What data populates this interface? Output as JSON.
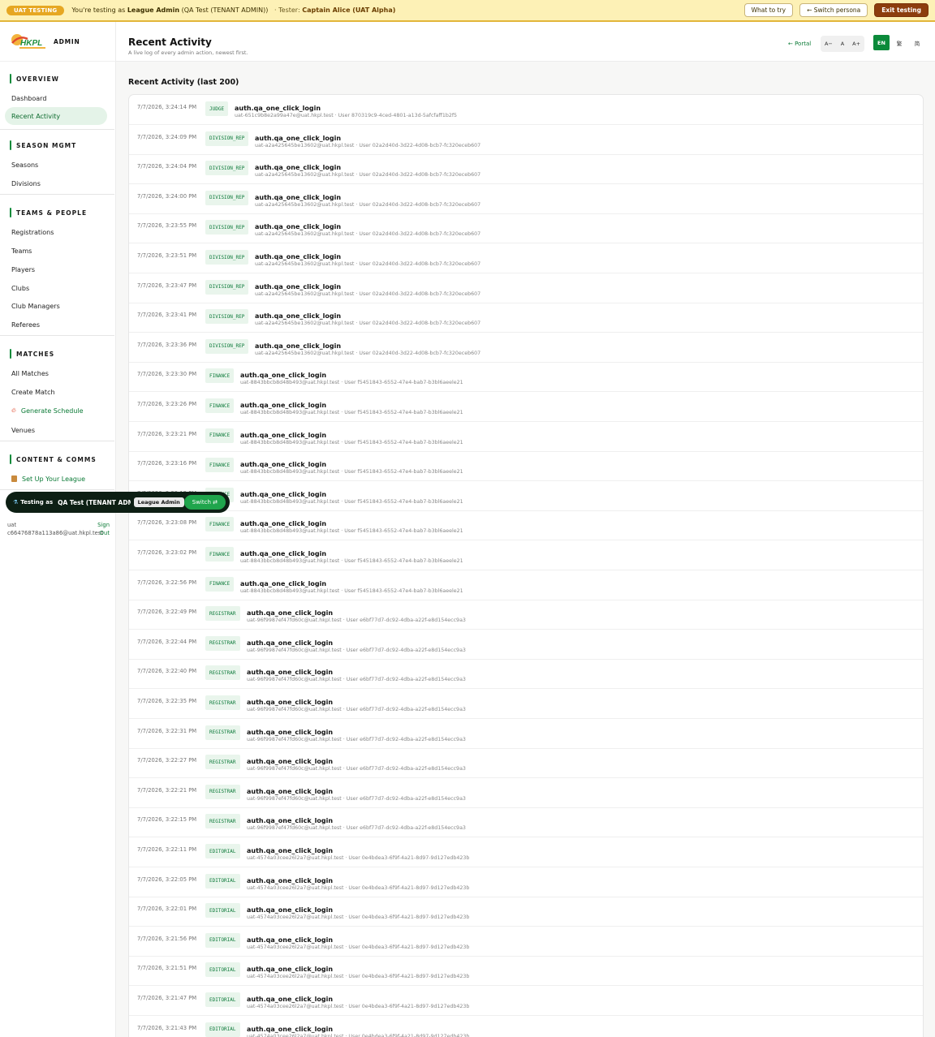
{
  "banner": {
    "pill": "UAT TESTING",
    "prefix": "You're testing as",
    "role": "League Admin",
    "role_detail": "(QA Test (TENANT ADMIN))",
    "tester_label": "· Tester:",
    "tester": "Captain Alice (UAT Alpha)",
    "what_to_try": "What to try",
    "switch_persona": "← Switch persona",
    "exit": "Exit testing"
  },
  "sidebar": {
    "brand_admin": "ADMIN",
    "sections": [
      {
        "title": "OVERVIEW",
        "items": [
          "Dashboard",
          "Recent Activity"
        ]
      },
      {
        "title": "SEASON MGMT",
        "items": [
          "Seasons",
          "Divisions"
        ]
      },
      {
        "title": "TEAMS & PEOPLE",
        "items": [
          "Registrations",
          "Teams",
          "Players",
          "Clubs",
          "Club Managers",
          "Referees"
        ]
      },
      {
        "title": "MATCHES",
        "items": [
          "All Matches",
          "Create Match",
          "Generate Schedule",
          "Venues"
        ]
      },
      {
        "title": "CONTENT & COMMS",
        "items": [
          "Set Up Your League"
        ]
      }
    ],
    "testing_pill": {
      "label": "Testing as",
      "name": "QA Test (TENANT ADMIN)",
      "persona": "League Admin",
      "switch": "Switch ⇄"
    },
    "user": {
      "line1": "uat",
      "line2": "c66476878a113a86@uat.hkpl.test",
      "signout1": "Sign",
      "signout2": "Out"
    }
  },
  "header": {
    "title": "Recent Activity",
    "subtitle": "A live log of every admin action, newest first.",
    "portal": "← Portal",
    "font_small": "A−",
    "font_normal": "A",
    "font_large": "A+",
    "lang_en": "EN",
    "lang_tc": "繁",
    "lang_sc": "简"
  },
  "section_title": "Recent Activity (last 200)",
  "log": [
    {
      "time": "7/7/2026, 3:24:14 PM",
      "role": "JUDGE",
      "action": "auth.qa_one_click_login",
      "detail": "uat-651c9b8e2a99a47e@uat.hkpl.test · User 870319c9-4ced-4801-a13d-5afcfaff1b2f5"
    },
    {
      "time": "7/7/2026, 3:24:09 PM",
      "role": "DIVISION_REP",
      "action": "auth.qa_one_click_login",
      "detail": "uat-a2a425645be13602@uat.hkpl.test · User 02a2d40d-3d22-4d08-bcb7-fc320eceb607"
    },
    {
      "time": "7/7/2026, 3:24:04 PM",
      "role": "DIVISION_REP",
      "action": "auth.qa_one_click_login",
      "detail": "uat-a2a425645be13602@uat.hkpl.test · User 02a2d40d-3d22-4d08-bcb7-fc320eceb607"
    },
    {
      "time": "7/7/2026, 3:24:00 PM",
      "role": "DIVISION_REP",
      "action": "auth.qa_one_click_login",
      "detail": "uat-a2a425645be13602@uat.hkpl.test · User 02a2d40d-3d22-4d08-bcb7-fc320eceb607"
    },
    {
      "time": "7/7/2026, 3:23:55 PM",
      "role": "DIVISION_REP",
      "action": "auth.qa_one_click_login",
      "detail": "uat-a2a425645be13602@uat.hkpl.test · User 02a2d40d-3d22-4d08-bcb7-fc320eceb607"
    },
    {
      "time": "7/7/2026, 3:23:51 PM",
      "role": "DIVISION_REP",
      "action": "auth.qa_one_click_login",
      "detail": "uat-a2a425645be13602@uat.hkpl.test · User 02a2d40d-3d22-4d08-bcb7-fc320eceb607"
    },
    {
      "time": "7/7/2026, 3:23:47 PM",
      "role": "DIVISION_REP",
      "action": "auth.qa_one_click_login",
      "detail": "uat-a2a425645be13602@uat.hkpl.test · User 02a2d40d-3d22-4d08-bcb7-fc320eceb607"
    },
    {
      "time": "7/7/2026, 3:23:41 PM",
      "role": "DIVISION_REP",
      "action": "auth.qa_one_click_login",
      "detail": "uat-a2a425645be13602@uat.hkpl.test · User 02a2d40d-3d22-4d08-bcb7-fc320eceb607"
    },
    {
      "time": "7/7/2026, 3:23:36 PM",
      "role": "DIVISION_REP",
      "action": "auth.qa_one_click_login",
      "detail": "uat-a2a425645be13602@uat.hkpl.test · User 02a2d40d-3d22-4d08-bcb7-fc320eceb607"
    },
    {
      "time": "7/7/2026, 3:23:30 PM",
      "role": "FINANCE",
      "action": "auth.qa_one_click_login",
      "detail": "uat-8843bbcb8d48b493@uat.hkpl.test · User f5451843-6552-47e4-bab7-b3bl6aeele21"
    },
    {
      "time": "7/7/2026, 3:23:26 PM",
      "role": "FINANCE",
      "action": "auth.qa_one_click_login",
      "detail": "uat-8843bbcb8d48b493@uat.hkpl.test · User f5451843-6552-47e4-bab7-b3bl6aeele21"
    },
    {
      "time": "7/7/2026, 3:23:21 PM",
      "role": "FINANCE",
      "action": "auth.qa_one_click_login",
      "detail": "uat-8843bbcb8d48b493@uat.hkpl.test · User f5451843-6552-47e4-bab7-b3bl6aeele21"
    },
    {
      "time": "7/7/2026, 3:23:16 PM",
      "role": "FINANCE",
      "action": "auth.qa_one_click_login",
      "detail": "uat-8843bbcb8d48b493@uat.hkpl.test · User f5451843-6552-47e4-bab7-b3bl6aeele21"
    },
    {
      "time": "7/7/2026, 3:23:12 PM",
      "role": "FINANCE",
      "action": "auth.qa_one_click_login",
      "detail": "uat-8843bbcb8d48b493@uat.hkpl.test · User f5451843-6552-47e4-bab7-b3bl6aeele21"
    },
    {
      "time": "7/7/2026, 3:23:08 PM",
      "role": "FINANCE",
      "action": "auth.qa_one_click_login",
      "detail": "uat-8843bbcb8d48b493@uat.hkpl.test · User f5451843-6552-47e4-bab7-b3bl6aeele21"
    },
    {
      "time": "7/7/2026, 3:23:02 PM",
      "role": "FINANCE",
      "action": "auth.qa_one_click_login",
      "detail": "uat-8843bbcb8d48b493@uat.hkpl.test · User f5451843-6552-47e4-bab7-b3bl6aeele21"
    },
    {
      "time": "7/7/2026, 3:22:56 PM",
      "role": "FINANCE",
      "action": "auth.qa_one_click_login",
      "detail": "uat-8843bbcb8d48b493@uat.hkpl.test · User f5451843-6552-47e4-bab7-b3bl6aeele21"
    },
    {
      "time": "7/7/2026, 3:22:49 PM",
      "role": "REGISTRAR",
      "action": "auth.qa_one_click_login",
      "detail": "uat-96f9987ef47fd60c@uat.hkpl.test · User e6bf77d7-dc92-4dba-a22f-e8d154ecc9a3"
    },
    {
      "time": "7/7/2026, 3:22:44 PM",
      "role": "REGISTRAR",
      "action": "auth.qa_one_click_login",
      "detail": "uat-96f9987ef47fd60c@uat.hkpl.test · User e6bf77d7-dc92-4dba-a22f-e8d154ecc9a3"
    },
    {
      "time": "7/7/2026, 3:22:40 PM",
      "role": "REGISTRAR",
      "action": "auth.qa_one_click_login",
      "detail": "uat-96f9987ef47fd60c@uat.hkpl.test · User e6bf77d7-dc92-4dba-a22f-e8d154ecc9a3"
    },
    {
      "time": "7/7/2026, 3:22:35 PM",
      "role": "REGISTRAR",
      "action": "auth.qa_one_click_login",
      "detail": "uat-96f9987ef47fd60c@uat.hkpl.test · User e6bf77d7-dc92-4dba-a22f-e8d154ecc9a3"
    },
    {
      "time": "7/7/2026, 3:22:31 PM",
      "role": "REGISTRAR",
      "action": "auth.qa_one_click_login",
      "detail": "uat-96f9987ef47fd60c@uat.hkpl.test · User e6bf77d7-dc92-4dba-a22f-e8d154ecc9a3"
    },
    {
      "time": "7/7/2026, 3:22:27 PM",
      "role": "REGISTRAR",
      "action": "auth.qa_one_click_login",
      "detail": "uat-96f9987ef47fd60c@uat.hkpl.test · User e6bf77d7-dc92-4dba-a22f-e8d154ecc9a3"
    },
    {
      "time": "7/7/2026, 3:22:21 PM",
      "role": "REGISTRAR",
      "action": "auth.qa_one_click_login",
      "detail": "uat-96f9987ef47fd60c@uat.hkpl.test · User e6bf77d7-dc92-4dba-a22f-e8d154ecc9a3"
    },
    {
      "time": "7/7/2026, 3:22:15 PM",
      "role": "REGISTRAR",
      "action": "auth.qa_one_click_login",
      "detail": "uat-96f9987ef47fd60c@uat.hkpl.test · User e6bf77d7-dc92-4dba-a22f-e8d154ecc9a3"
    },
    {
      "time": "7/7/2026, 3:22:11 PM",
      "role": "EDITORIAL",
      "action": "auth.qa_one_click_login",
      "detail": "uat-4574a03cee26l2a7@uat.hkpl.test · User 0e4bdea3-6f9f-4a21-8d97-9d127edb423b"
    },
    {
      "time": "7/7/2026, 3:22:05 PM",
      "role": "EDITORIAL",
      "action": "auth.qa_one_click_login",
      "detail": "uat-4574a03cee26l2a7@uat.hkpl.test · User 0e4bdea3-6f9f-4a21-8d97-9d127edb423b"
    },
    {
      "time": "7/7/2026, 3:22:01 PM",
      "role": "EDITORIAL",
      "action": "auth.qa_one_click_login",
      "detail": "uat-4574a03cee26l2a7@uat.hkpl.test · User 0e4bdea3-6f9f-4a21-8d97-9d127edb423b"
    },
    {
      "time": "7/7/2026, 3:21:56 PM",
      "role": "EDITORIAL",
      "action": "auth.qa_one_click_login",
      "detail": "uat-4574a03cee26l2a7@uat.hkpl.test · User 0e4bdea3-6f9f-4a21-8d97-9d127edb423b"
    },
    {
      "time": "7/7/2026, 3:21:51 PM",
      "role": "EDITORIAL",
      "action": "auth.qa_one_click_login",
      "detail": "uat-4574a03cee26l2a7@uat.hkpl.test · User 0e4bdea3-6f9f-4a21-8d97-9d127edb423b"
    },
    {
      "time": "7/7/2026, 3:21:47 PM",
      "role": "EDITORIAL",
      "action": "auth.qa_one_click_login",
      "detail": "uat-4574a03cee26l2a7@uat.hkpl.test · User 0e4bdea3-6f9f-4a21-8d97-9d127edb423b"
    },
    {
      "time": "7/7/2026, 3:21:43 PM",
      "role": "EDITORIAL",
      "action": "auth.qa_one_click_login",
      "detail": "uat-4574a03cee26l2a7@uat.hkpl.test · User 0e4bdea3-6f9f-4a21-8d97-9d127edb423b"
    }
  ],
  "colors": {
    "accent": "#0b8a3a",
    "banner_bg": "#fdf1b6",
    "banner_pill": "#e6a722",
    "exit_button": "#8c3d0d",
    "badge_bg": "#e9f5ec"
  },
  "icons": {
    "portal": "arrow-left-icon",
    "generate_schedule": "flame-icon",
    "setup_league": "clipboard-icon",
    "testing": "flask-icon"
  }
}
